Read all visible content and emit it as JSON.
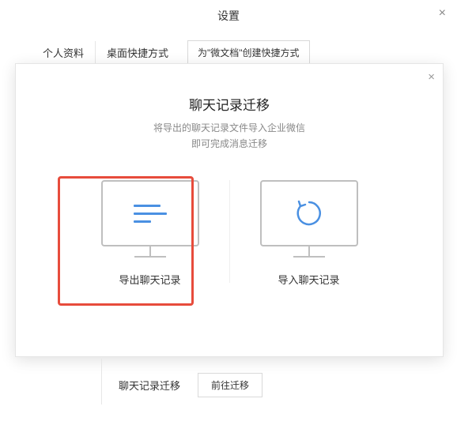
{
  "window": {
    "title": "设置"
  },
  "tabs": {
    "profile": "个人资料",
    "desktop_shortcut": "桌面快捷方式",
    "create_shortcut_button": "为\"微文档\"创建快捷方式"
  },
  "modal": {
    "title": "聊天记录迁移",
    "subtitle1": "将导出的聊天记录文件导入企业微信",
    "subtitle2": "即可完成消息迁移",
    "export_label": "导出聊天记录",
    "import_label": "导入聊天记录"
  },
  "bottom": {
    "label": "聊天记录迁移",
    "button": "前往迁移"
  }
}
